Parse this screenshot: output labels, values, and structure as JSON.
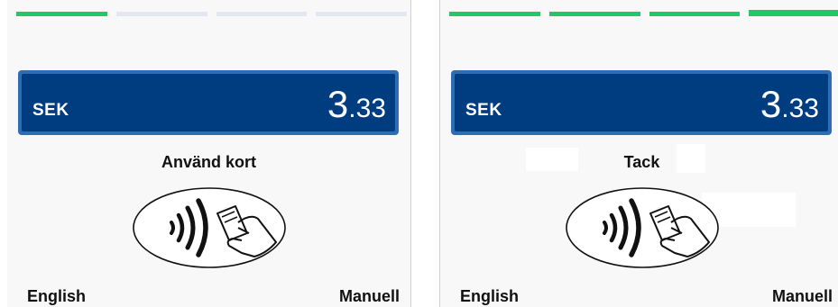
{
  "colors": {
    "progress_done": "#25c56a",
    "progress_pending": "#e3e8f0",
    "amount_bg": "#003d80",
    "amount_border": "#2e6db4"
  },
  "left_screen": {
    "progress_steps_done": 1,
    "progress_steps_total": 4,
    "currency": "SEK",
    "amount_int": "3",
    "amount_dec": ".33",
    "prompt": "Använd kort",
    "icon": "contactless-card-tap-icon",
    "soft_left": "English",
    "soft_right": "Manuell"
  },
  "right_screen": {
    "progress_steps_done": 4,
    "progress_steps_total": 4,
    "currency": "SEK",
    "amount_int": "3",
    "amount_dec": ".33",
    "prompt": "Tack",
    "icon": "contactless-card-tap-icon",
    "soft_left": "English",
    "soft_right": "Manuell"
  }
}
